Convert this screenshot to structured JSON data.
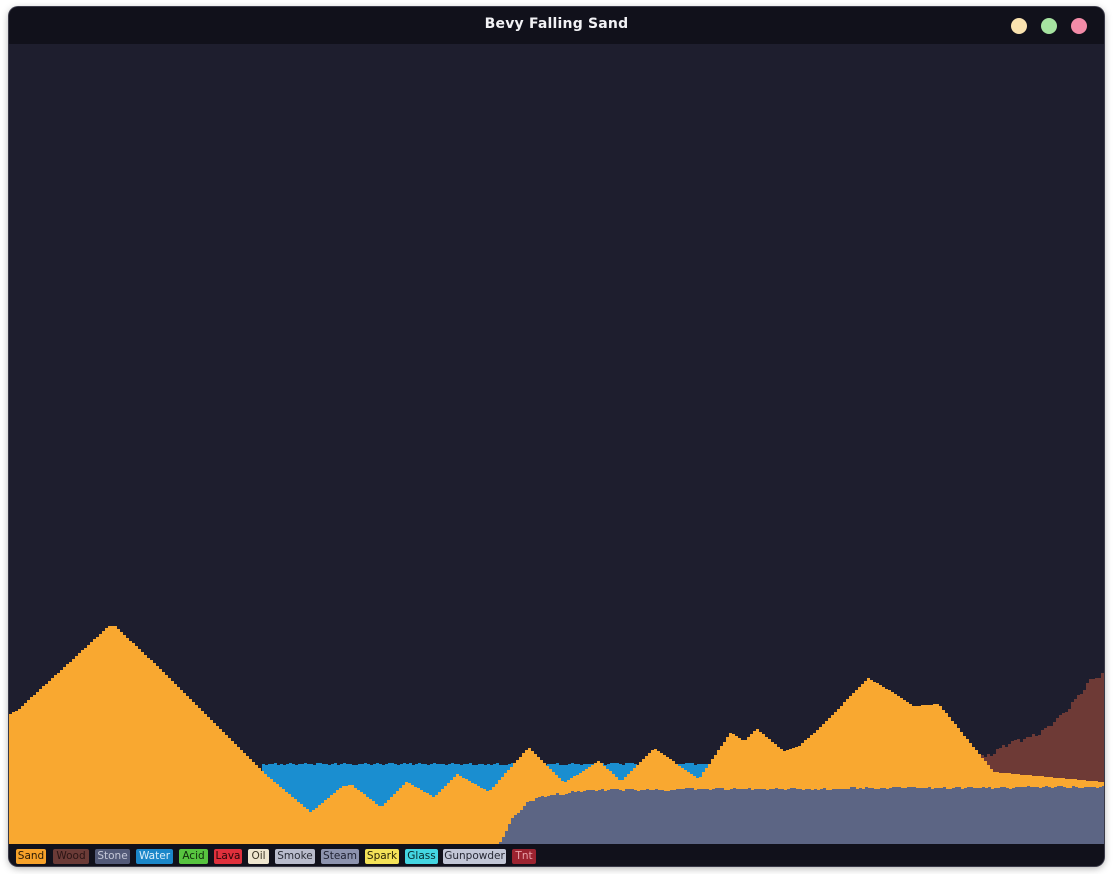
{
  "window": {
    "title": "Bevy Falling Sand",
    "controls": [
      {
        "name": "minimize-button",
        "color": "#f9e2af"
      },
      {
        "name": "maximize-button",
        "color": "#a6e3a1"
      },
      {
        "name": "close-button",
        "color": "#f38ba8"
      }
    ]
  },
  "scene": {
    "background": "#1e1e2e",
    "colors": {
      "sand": "#f9a830",
      "water": "#1a8ed0",
      "stone": "#5c6584",
      "wood": "#6e3a36"
    }
  },
  "palette": [
    {
      "label": "Sand",
      "bg": "#f7a22a",
      "fg": "#2a1a05"
    },
    {
      "label": "Wood",
      "bg": "#6b3b37",
      "fg": "#2a1414"
    },
    {
      "label": "Stone",
      "bg": "#535a78",
      "fg": "#c5c8d8"
    },
    {
      "label": "Water",
      "bg": "#1b87c9",
      "fg": "#dbeefa"
    },
    {
      "label": "Acid",
      "bg": "#57c43f",
      "fg": "#0f2a0a"
    },
    {
      "label": "Lava",
      "bg": "#e0303c",
      "fg": "#2a0608"
    },
    {
      "label": "Oil",
      "bg": "#efe6cf",
      "fg": "#3a3424"
    },
    {
      "label": "Smoke",
      "bg": "#b9bccc",
      "fg": "#2a2c36"
    },
    {
      "label": "Steam",
      "bg": "#8d93ae",
      "fg": "#1e2030"
    },
    {
      "label": "Spark",
      "bg": "#f4e258",
      "fg": "#2a2406"
    },
    {
      "label": "Glass",
      "bg": "#44d6e2",
      "fg": "#072a2e"
    },
    {
      "label": "Gunpowder",
      "bg": "#c2c6d6",
      "fg": "#262834"
    },
    {
      "label": "Tnt",
      "bg": "#9c2330",
      "fg": "#e8a0a8"
    }
  ]
}
